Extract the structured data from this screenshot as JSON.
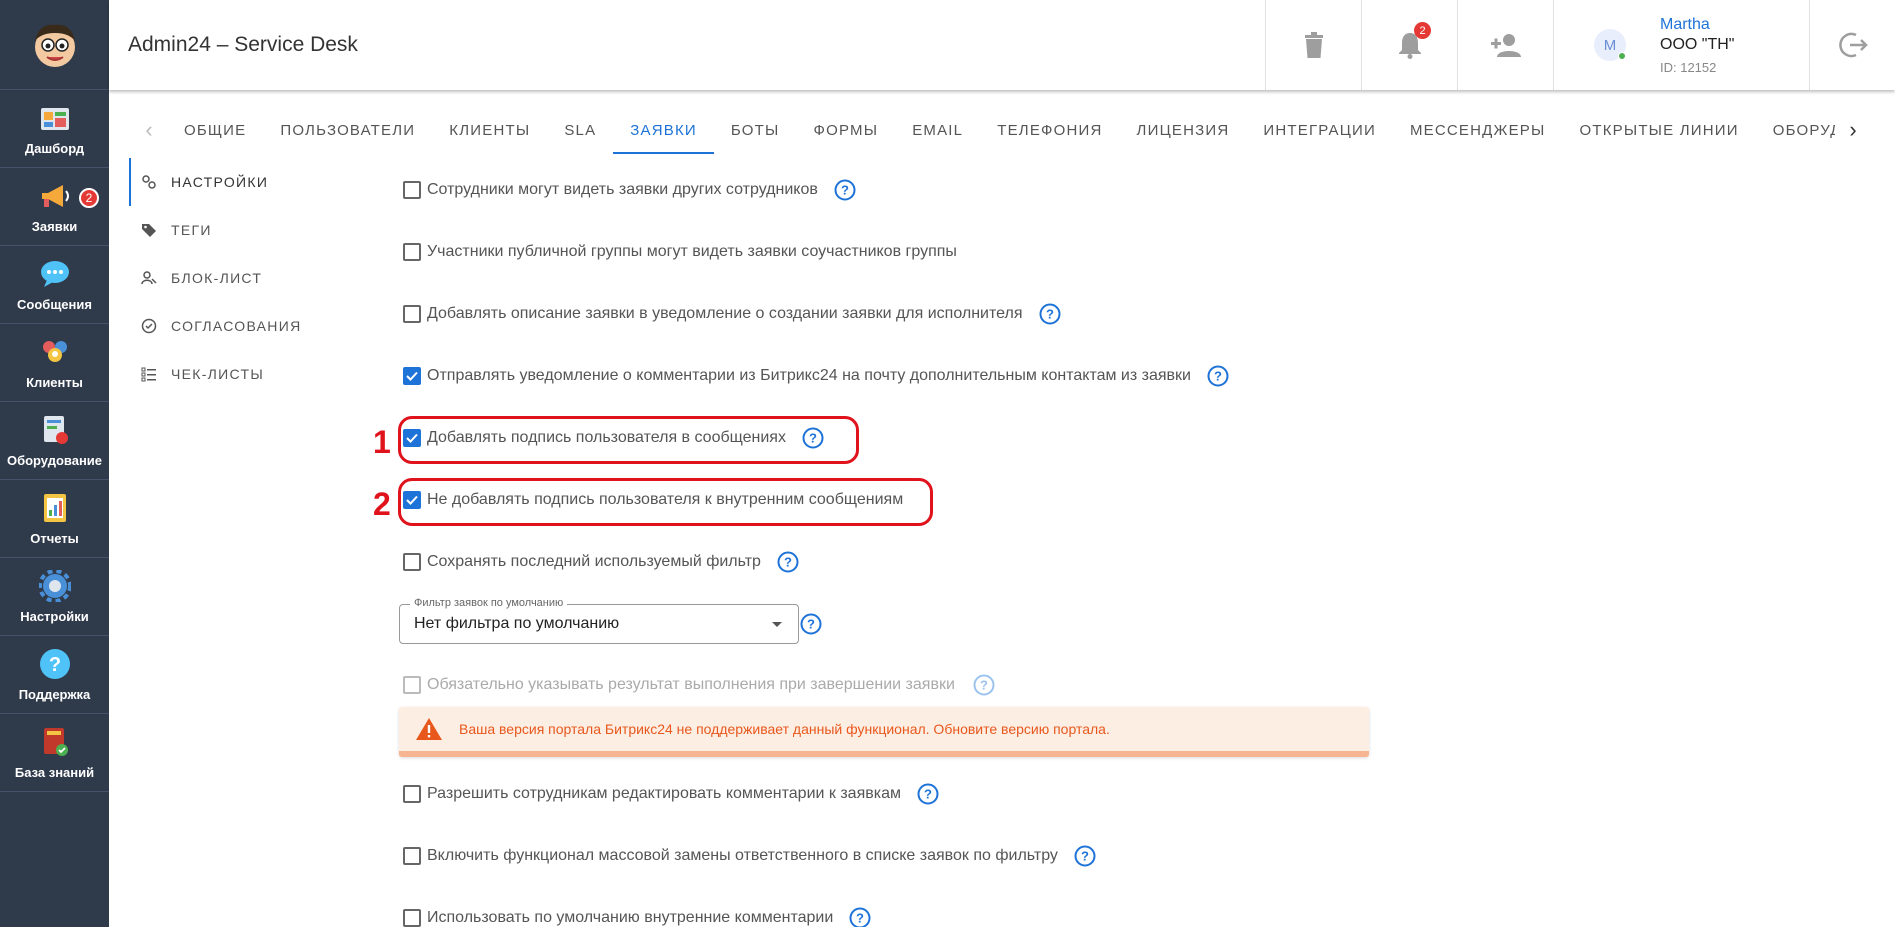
{
  "header": {
    "title": "Admin24 – Service Desk",
    "notifications_count": "2",
    "user": {
      "avatar_letter": "M",
      "name": "Martha",
      "org": "ООО \"ТН\"",
      "id": "ID: 12152"
    }
  },
  "sidebar": {
    "items": [
      {
        "label": "Дашборд",
        "icon": "dashboard-icon"
      },
      {
        "label": "Заявки",
        "icon": "megaphone-icon",
        "badge": "2"
      },
      {
        "label": "Сообщения",
        "icon": "chat-icon"
      },
      {
        "label": "Клиенты",
        "icon": "clients-icon"
      },
      {
        "label": "Оборудование",
        "icon": "equipment-icon"
      },
      {
        "label": "Отчеты",
        "icon": "reports-icon"
      },
      {
        "label": "Настройки",
        "icon": "gear-icon"
      },
      {
        "label": "Поддержка",
        "icon": "help-icon"
      },
      {
        "label": "База знаний",
        "icon": "book-icon"
      }
    ]
  },
  "tabs": [
    "ОБЩИЕ",
    "ПОЛЬЗОВАТЕЛИ",
    "КЛИЕНТЫ",
    "SLA",
    "ЗАЯВКИ",
    "БОТЫ",
    "ФОРМЫ",
    "EMAIL",
    "ТЕЛЕФОНИЯ",
    "ЛИЦЕНЗИЯ",
    "ИНТЕГРАЦИИ",
    "МЕССЕНДЖЕРЫ",
    "ОТКРЫТЫЕ ЛИНИИ",
    "ОБОРУДОВАН"
  ],
  "active_tab": "ЗАЯВКИ",
  "subnav": [
    "НАСТРОЙКИ",
    "ТЕГИ",
    "БЛОК-ЛИСТ",
    "СОГЛАСОВАНИЯ",
    "ЧЕК-ЛИСТЫ"
  ],
  "settings": [
    {
      "label": "Сотрудники могут видеть заявки других сотрудников",
      "checked": false,
      "help": true
    },
    {
      "label": "Участники публичной группы могут видеть заявки соучастников группы",
      "checked": false,
      "help": false
    },
    {
      "label": "Добавлять описание заявки в уведомление о создании заявки для исполнителя",
      "checked": false,
      "help": true
    },
    {
      "label": "Отправлять уведомление о комментарии из Битрикс24 на почту дополнительным контактам из заявки",
      "checked": true,
      "help": true
    },
    {
      "label": "Добавлять подпись пользователя в сообщениях",
      "checked": true,
      "help": true
    },
    {
      "label": "Не добавлять подпись пользователя к внутренним сообщениям",
      "checked": true,
      "help": false
    },
    {
      "label": "Сохранять последний используемый фильтр",
      "checked": false,
      "help": true
    }
  ],
  "default_filter": {
    "legend": "Фильтр заявок по умолчанию",
    "value": "Нет фильтра по умолчанию"
  },
  "disabled_setting": {
    "label": "Обязательно указывать результат выполнения при завершении заявки"
  },
  "alert": {
    "text": "Ваша версия портала Битрикс24 не поддерживает данный функционал. Обновите версию портала."
  },
  "settings_after": [
    {
      "label": "Разрешить сотрудникам редактировать комментарии к заявкам",
      "checked": false,
      "help": true
    },
    {
      "label": "Включить функционал массовой замены ответственного в списке заявок по фильтру",
      "checked": false,
      "help": true
    },
    {
      "label": "Использовать по умолчанию внутренние комментарии",
      "checked": false,
      "help": true
    }
  ],
  "annotations": {
    "one": "1",
    "two": "2"
  },
  "colors": {
    "sidebar": "#2f3a4b",
    "accent": "#1e73d8",
    "highlight": "#e0131c",
    "alert_text": "#e8581c"
  }
}
